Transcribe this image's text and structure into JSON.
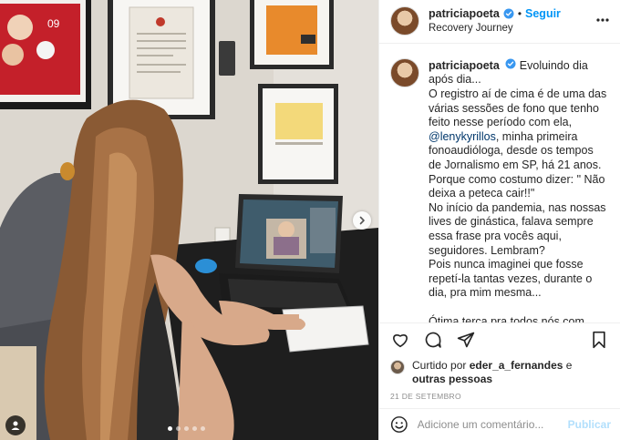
{
  "post": {
    "username": "patriciapoeta",
    "follow_label": "Seguir",
    "separator": "•",
    "location": "Recovery Journey",
    "caption": {
      "lines": [
        "Evoluindo dia após dia...",
        "O registro aí de cima é de uma das várias sessões de fono que tenho feito nesse período com ela,",
        "minha primeira fonoaudióloga, desde os tempos de Jornalismo em SP, há 21 anos.",
        "Porque como costumo dizer: \" Não deixa a peteca cair!!\"",
        "No início da pandemia, nas nossas lives de ginástica, falava sempre essa frase pra vocês aqui, seguidores. Lembram?",
        "Pois nunca imaginei que fosse repetí-la tantas vezes, durante o dia, pra mim mesma...",
        "Ótima terça pra todos nós com energia, foco e pensamento positivo sempre!"
      ],
      "mention": "@lenykyrillos",
      "mention_suffix": ","
    },
    "likes": {
      "prefix": "Curtido por",
      "liker": "eder_a_fernandes",
      "suffix": "e",
      "others": "outras pessoas"
    },
    "date": "21 DE SETEMBRO",
    "comment_placeholder": "Adicione um comentário...",
    "publish_label": "Publicar"
  },
  "carousel": {
    "slides": 5,
    "active_index": 0
  },
  "icons": {
    "verified": "verified-badge-icon",
    "more": "more-options-icon",
    "like": "heart-icon",
    "comment": "comment-bubble-icon",
    "share": "paper-plane-icon",
    "save": "bookmark-icon",
    "emoji": "emoji-icon",
    "next": "chevron-right-icon",
    "tag": "user-tag-icon"
  },
  "colors": {
    "accent": "#0095f6",
    "verified": "#3897f0",
    "mention": "#00376b",
    "publish_disabled": "#b2dffc",
    "muted": "#8e8e8e",
    "text": "#262626"
  }
}
